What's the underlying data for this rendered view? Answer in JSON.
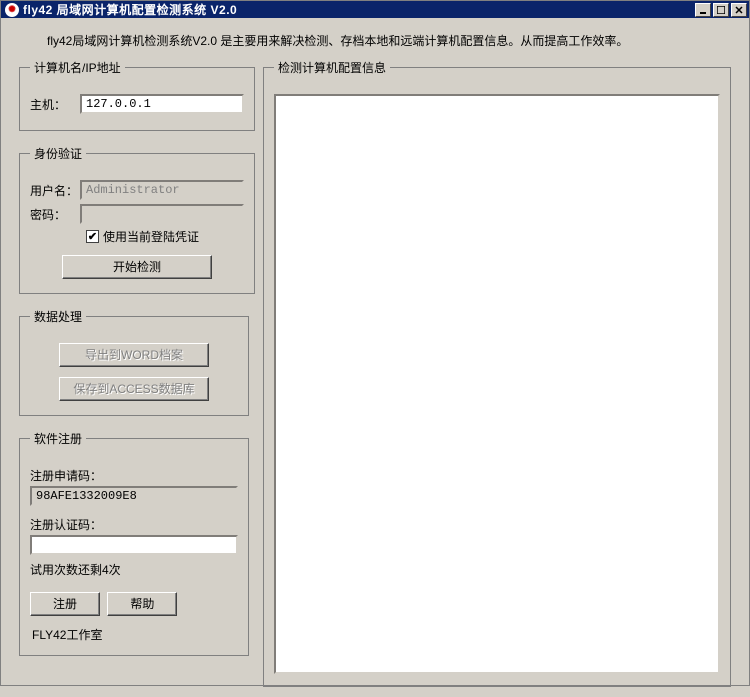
{
  "window": {
    "title": "fly42 局域网计算机配置检测系统 V2.0"
  },
  "description": "fly42局域网计算机检测系统V2.0 是主要用来解决检测、存档本地和远端计算机配置信息。从而提高工作效率。",
  "groups": {
    "host": {
      "legend": "计算机名/IP地址",
      "host_label": "主机：",
      "host_value": "127.0.0.1"
    },
    "auth": {
      "legend": "身份验证",
      "user_label": "用户名：",
      "user_value": "Administrator",
      "pass_label": "密码：",
      "pass_value": "",
      "checkbox_label": "使用当前登陆凭证",
      "checkbox_checked": true,
      "start_btn": "开始检测"
    },
    "data": {
      "legend": "数据处理",
      "export_word_btn": "导出到WORD档案",
      "save_access_btn": "保存到ACCESS数据库"
    },
    "reg": {
      "legend": "软件注册",
      "request_code_label": "注册申请码：",
      "request_code_value": "98AFE1332009E8",
      "auth_code_label": "注册认证码：",
      "auth_code_value": "",
      "trial_note": "试用次数还剩4次",
      "register_btn": "注册",
      "help_btn": "帮助",
      "studio": "FLY42工作室"
    },
    "result": {
      "legend": "检测计算机配置信息"
    }
  }
}
